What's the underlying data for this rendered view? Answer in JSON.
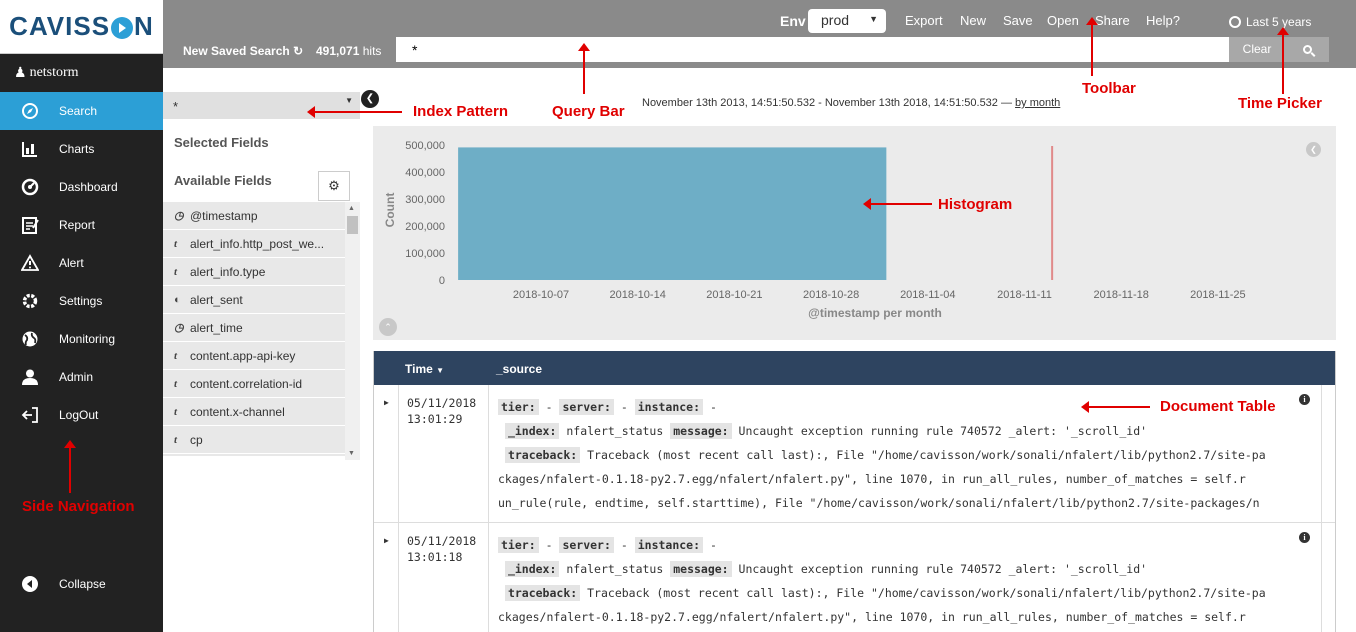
{
  "brand": {
    "logo_left": "CAVISS",
    "logo_right": "N"
  },
  "user": {
    "name": "netstorm"
  },
  "sidebar": {
    "items": [
      {
        "label": "Search"
      },
      {
        "label": "Charts"
      },
      {
        "label": "Dashboard"
      },
      {
        "label": "Report"
      },
      {
        "label": "Alert"
      },
      {
        "label": "Settings"
      },
      {
        "label": "Monitoring"
      },
      {
        "label": "Admin"
      },
      {
        "label": "LogOut"
      }
    ],
    "collapse_label": "Collapse"
  },
  "toolbar": {
    "env_label": "Env",
    "env_value": "prod",
    "export_label": "Export",
    "new_label": "New",
    "save_label": "Save",
    "open_label": "Open",
    "share_label": "Share",
    "help_label": "Help?",
    "time_picker": "Last 5 years",
    "saved_search": "New Saved Search",
    "hits_count": "491,071",
    "hits_label": "hits",
    "query_value": "*",
    "clear_label": "Clear"
  },
  "fields": {
    "index_pattern": "*",
    "selected_title": "Selected Fields",
    "available_title": "Available Fields",
    "items": [
      {
        "type": "clock",
        "name": "@timestamp"
      },
      {
        "type": "t",
        "name": "alert_info.http_post_we..."
      },
      {
        "type": "t",
        "name": "alert_info.type"
      },
      {
        "type": "bool",
        "name": "alert_sent"
      },
      {
        "type": "clock",
        "name": "alert_time"
      },
      {
        "type": "t",
        "name": "content.app-api-key"
      },
      {
        "type": "t",
        "name": "content.correlation-id"
      },
      {
        "type": "t",
        "name": "content.x-channel"
      },
      {
        "type": "t",
        "name": "cp"
      }
    ]
  },
  "histogram": {
    "range_text": "November 13th 2013, 14:51:50.532 - November 13th 2018, 14:51:50.532 —",
    "interval_link": "by month"
  },
  "chart_data": {
    "type": "bar",
    "xlabel": "@timestamp per month",
    "ylabel": "Count",
    "ylim": [
      0,
      500000
    ],
    "yticks": [
      0,
      100000,
      200000,
      300000,
      400000,
      500000
    ],
    "ytick_labels": [
      "0",
      "100,000",
      "200,000",
      "300,000",
      "400,000",
      "500,000"
    ],
    "xtick_labels": [
      "2018-10-07",
      "2018-10-14",
      "2018-10-21",
      "2018-10-28",
      "2018-11-04",
      "2018-11-11",
      "2018-11-18",
      "2018-11-25"
    ],
    "bars": [
      {
        "start": "2018-10-01",
        "end": "2018-11-01",
        "value": 491071
      }
    ],
    "marker": "2018-11-13",
    "grid": false,
    "colors": {
      "bar": "#6eaec6",
      "marker": "#e08a8a"
    }
  },
  "table": {
    "time_header": "Time",
    "source_header": "_source",
    "rows": [
      {
        "date": "05/11/2018",
        "time": "13:01:29",
        "tier_key": "tier:",
        "tier_val": "-",
        "server_key": "server:",
        "server_val": "-",
        "instance_key": "instance:",
        "instance_val": "-",
        "index_key": "_index:",
        "index_val": "nfalert_status",
        "message_key": "message:",
        "message_val": "Uncaught exception running rule 740572 _alert: '_scroll_id'",
        "traceback_key": "traceback:",
        "traceback_val": "Traceback (most recent call last):,   File \"/home/cavisson/work/sonali/nfalert/lib/python2.7/site-pa",
        "line3": "ckages/nfalert-0.1.18-py2.7.egg/nfalert/nfalert.py\", line 1070, in run_all_rules,     number_of_matches = self.r",
        "line4": "un_rule(rule, endtime, self.starttime),   File \"/home/cavisson/work/sonali/nfalert/lib/python2.7/site-packages/n"
      },
      {
        "date": "05/11/2018",
        "time": "13:01:18",
        "tier_key": "tier:",
        "tier_val": "-",
        "server_key": "server:",
        "server_val": "-",
        "instance_key": "instance:",
        "instance_val": "-",
        "index_key": "_index:",
        "index_val": "nfalert_status",
        "message_key": "message:",
        "message_val": "Uncaught exception running rule 740572 _alert: '_scroll_id'",
        "traceback_key": "traceback:",
        "traceback_val": "Traceback (most recent call last):,   File \"/home/cavisson/work/sonali/nfalert/lib/python2.7/site-pa",
        "line3": "ckages/nfalert-0.1.18-py2.7.egg/nfalert/nfalert.py\", line 1070, in run_all_rules,     number_of_matches = self.r",
        "line4": ""
      }
    ]
  },
  "annotations": {
    "index_pattern": "Index Pattern",
    "query_bar": "Query Bar",
    "toolbar": "Toolbar",
    "time_picker": "Time Picker",
    "histogram": "Histogram",
    "document_table": "Document Table",
    "side_navigation": "Side Navigation"
  }
}
